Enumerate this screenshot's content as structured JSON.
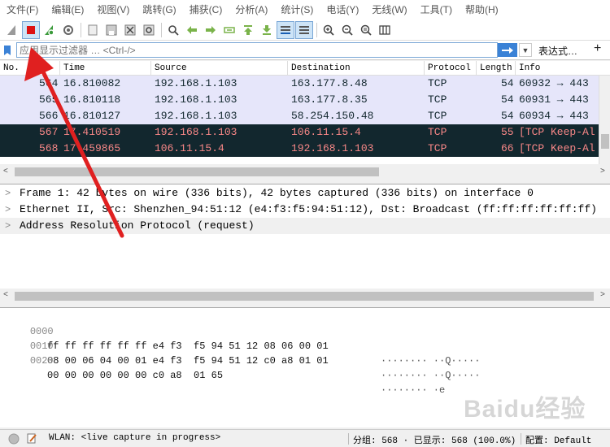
{
  "menu": [
    "文件(F)",
    "编辑(E)",
    "视图(V)",
    "跳转(G)",
    "捕获(C)",
    "分析(A)",
    "统计(S)",
    "电话(Y)",
    "无线(W)",
    "工具(T)",
    "帮助(H)"
  ],
  "filter": {
    "placeholder": "应用显示过滤器 … <Ctrl-/>",
    "expression_label": "表达式…",
    "plus": "+"
  },
  "columns": [
    "No.",
    "Time",
    "Source",
    "Destination",
    "Protocol",
    "Length",
    "Info"
  ],
  "packets": [
    {
      "no": "564",
      "time": "16.810082",
      "src": "192.168.1.103",
      "dst": "163.177.8.48",
      "proto": "TCP",
      "len": "54",
      "info": "60932 → 443"
    },
    {
      "no": "565",
      "time": "16.810118",
      "src": "192.168.1.103",
      "dst": "163.177.8.35",
      "proto": "TCP",
      "len": "54",
      "info": "60931 → 443"
    },
    {
      "no": "566",
      "time": "16.810127",
      "src": "192.168.1.103",
      "dst": "58.254.150.48",
      "proto": "TCP",
      "len": "54",
      "info": "60934 → 443"
    },
    {
      "no": "567",
      "time": "17.410519",
      "src": "192.168.1.103",
      "dst": "106.11.15.4",
      "proto": "TCP",
      "len": "55",
      "info": "[TCP Keep-Al"
    },
    {
      "no": "568",
      "time": "17.459865",
      "src": "106.11.15.4",
      "dst": "192.168.1.103",
      "proto": "TCP",
      "len": "66",
      "info": "[TCP Keep-Al"
    }
  ],
  "details": [
    "Frame 1: 42 bytes on wire (336 bits), 42 bytes captured (336 bits) on interface 0",
    "Ethernet II, Src: Shenzhen_94:51:12 (e4:f3:f5:94:51:12), Dst: Broadcast (ff:ff:ff:ff:ff:ff)",
    "Address Resolution Protocol (request)"
  ],
  "bytes": [
    {
      "offset": "0000",
      "hex": "ff ff ff ff ff ff e4 f3  f5 94 51 12 08 06 00 01",
      "ascii": "········ ··Q·····"
    },
    {
      "offset": "0010",
      "hex": "08 00 06 04 00 01 e4 f3  f5 94 51 12 c0 a8 01 01",
      "ascii": "········ ··Q·····"
    },
    {
      "offset": "0020",
      "hex": "00 00 00 00 00 00 c0 a8  01 65",
      "ascii": "········ ·e"
    }
  ],
  "status": {
    "interface": "WLAN: <live capture in progress>",
    "packets": "分组: 568 · 已显示: 568 (100.0%)",
    "profile": "配置: Default"
  },
  "watermark": "Baidu经验",
  "colors": {
    "row_normal_bg": "#e6e6fa",
    "row_keepalive_bg": "#12272e",
    "row_keepalive_fg": "#f78787",
    "annotation_arrow": "#e02020"
  }
}
